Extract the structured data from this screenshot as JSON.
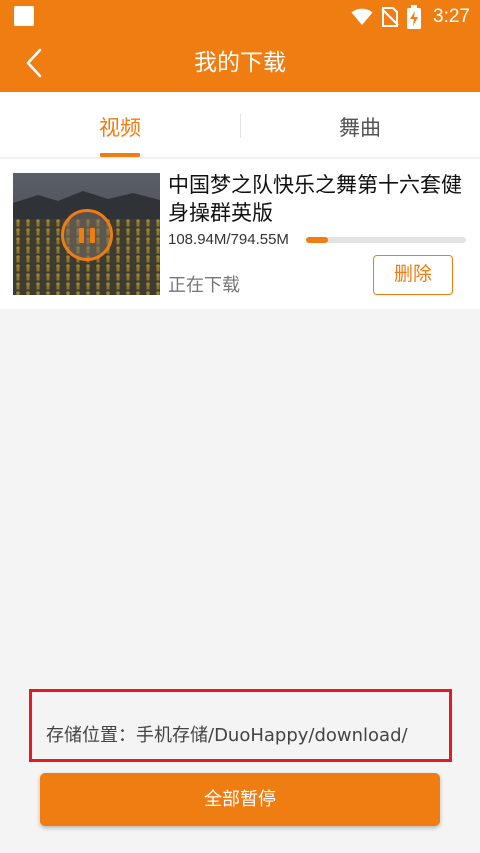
{
  "statusbar": {
    "time": "3:27",
    "icons": [
      "app-notification-icon",
      "wifi-icon",
      "no-sim-icon",
      "battery-charging-icon"
    ]
  },
  "appbar": {
    "title": "我的下载",
    "back_icon": "chevron-left-icon"
  },
  "tabs": [
    {
      "label": "视频",
      "active": true
    },
    {
      "label": "舞曲",
      "active": false
    }
  ],
  "download_item": {
    "title": "中国梦之队快乐之舞第十六套健身操群英版",
    "size": "108.94M/794.55M",
    "progress": 0.137,
    "status": "正在下载",
    "delete_label": "删除",
    "pause_icon": "pause-icon"
  },
  "storage": {
    "label": "存储位置：手机存储/DuoHappy/download/"
  },
  "footer": {
    "pause_all_label": "全部暂停"
  },
  "colors": {
    "accent": "#f07d12",
    "highlight_box": "#e11b22",
    "background": "#f4f4f4"
  }
}
